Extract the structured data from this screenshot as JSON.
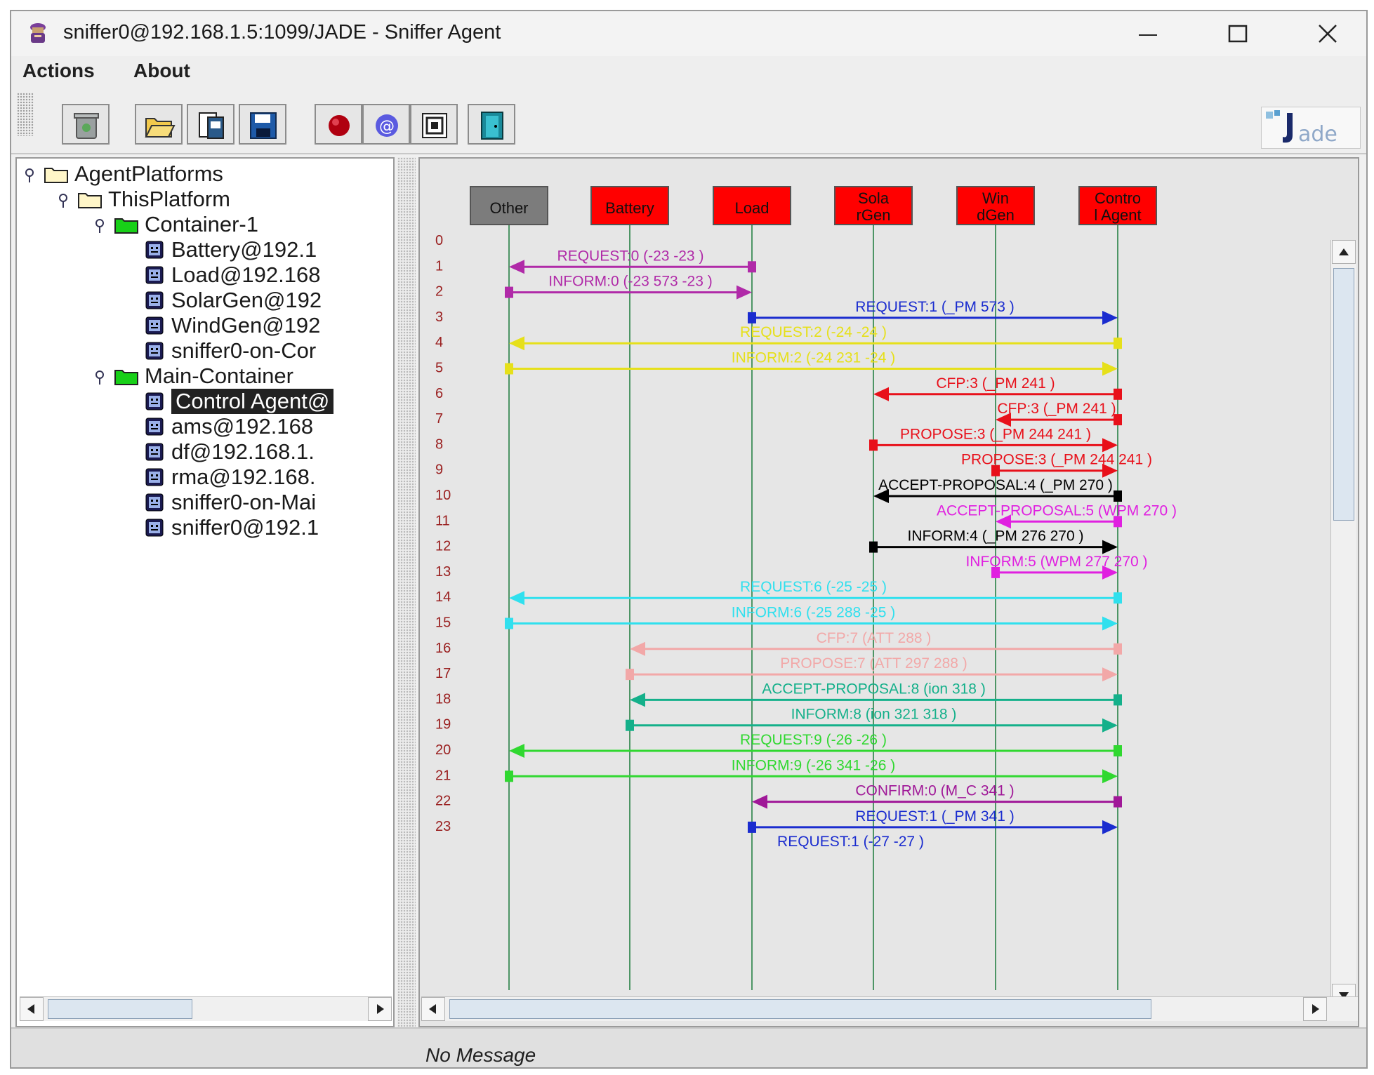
{
  "window": {
    "title": "sniffer0@192.168.1.5:1099/JADE - Sniffer Agent",
    "minimize_icon": "minimize-icon",
    "maximize_icon": "maximize-icon",
    "close_icon": "close-icon"
  },
  "menu": {
    "items": [
      "Actions",
      "About"
    ]
  },
  "toolbar": {
    "buttons": [
      {
        "icon": "trash-icon"
      },
      {
        "icon": "open-folder-icon"
      },
      {
        "icon": "document-icon"
      },
      {
        "icon": "save-icon"
      },
      {
        "icon": "record-icon"
      },
      {
        "icon": "at-icon"
      },
      {
        "icon": "filter-icon"
      },
      {
        "icon": "exit-door-icon"
      }
    ],
    "logo": "Jade"
  },
  "tree": {
    "nodes": [
      {
        "label": "AgentPlatforms",
        "type": "folder"
      },
      {
        "label": "ThisPlatform",
        "type": "folder"
      },
      {
        "label": "Container-1",
        "type": "container"
      },
      {
        "label": "Battery@192.1",
        "type": "agent"
      },
      {
        "label": "Load@192.168",
        "type": "agent"
      },
      {
        "label": "SolarGen@192",
        "type": "agent"
      },
      {
        "label": "WindGen@192",
        "type": "agent"
      },
      {
        "label": "sniffer0-on-Cor",
        "type": "agent"
      },
      {
        "label": "Main-Container",
        "type": "container"
      },
      {
        "label": "Control Agent@",
        "type": "agent",
        "selected": true
      },
      {
        "label": "ams@192.168",
        "type": "agent"
      },
      {
        "label": "df@192.168.1.",
        "type": "agent"
      },
      {
        "label": "rma@192.168.",
        "type": "agent"
      },
      {
        "label": "sniffer0-on-Mai",
        "type": "agent"
      },
      {
        "label": "sniffer0@192.1",
        "type": "agent"
      }
    ]
  },
  "diagram": {
    "agents": [
      {
        "label": "Other",
        "color": "#7c7c7c"
      },
      {
        "label": "Battery",
        "color": "#ff0000"
      },
      {
        "label": "Load",
        "color": "#ff0000"
      },
      {
        "label": "Sola\nrGen",
        "color": "#ff0000"
      },
      {
        "label": "Win\ndGen",
        "color": "#ff0000"
      },
      {
        "label": "Contro\nl Agent",
        "color": "#ff0000"
      }
    ],
    "row_numbers": [
      "0",
      "1",
      "2",
      "3",
      "4",
      "5",
      "6",
      "7",
      "8",
      "9",
      "10",
      "11",
      "12",
      "13",
      "14",
      "15",
      "16",
      "17",
      "18",
      "19",
      "20",
      "21",
      "22",
      "23"
    ],
    "messages": [
      {
        "row": 1,
        "from": 2,
        "to": 0,
        "label": "REQUEST:0 (-23  -23    )",
        "color": "#b02aa8"
      },
      {
        "row": 2,
        "from": 0,
        "to": 2,
        "label": "INFORM:0 (-23  573  -23 )",
        "color": "#b02aa8"
      },
      {
        "row": 3,
        "from": 2,
        "to": 5,
        "label": "REQUEST:1 (_PM  573    )",
        "color": "#1a2ccf"
      },
      {
        "row": 4,
        "from": 5,
        "to": 0,
        "label": "REQUEST:2 (-24  -24    )",
        "color": "#e6e01a"
      },
      {
        "row": 5,
        "from": 0,
        "to": 5,
        "label": "INFORM:2 (-24  231  -24 )",
        "color": "#e6e01a"
      },
      {
        "row": 6,
        "from": 5,
        "to": 3,
        "label": "CFP:3 (_PM  241    )",
        "color": "#e8101a"
      },
      {
        "row": 7,
        "from": 5,
        "to": 4,
        "label": "CFP:3 (_PM  241    )",
        "color": "#e8101a"
      },
      {
        "row": 8,
        "from": 3,
        "to": 5,
        "label": "PROPOSE:3 (_PM  244  241 )",
        "color": "#e8101a"
      },
      {
        "row": 9,
        "from": 4,
        "to": 5,
        "label": "PROPOSE:3 (_PM  244  241 )",
        "color": "#e8101a"
      },
      {
        "row": 10,
        "from": 5,
        "to": 3,
        "label": "ACCEPT-PROPOSAL:4 (_PM  270    )",
        "color": "#000000"
      },
      {
        "row": 11,
        "from": 5,
        "to": 4,
        "label": "ACCEPT-PROPOSAL:5 (WPM  270    )",
        "color": "#e020e0"
      },
      {
        "row": 12,
        "from": 3,
        "to": 5,
        "label": "INFORM:4 (_PM  276  270 )",
        "color": "#000000"
      },
      {
        "row": 13,
        "from": 4,
        "to": 5,
        "label": "INFORM:5 (WPM  277  270 )",
        "color": "#e020e0"
      },
      {
        "row": 14,
        "from": 5,
        "to": 0,
        "label": "REQUEST:6 (-25  -25    )",
        "color": "#30e0ee"
      },
      {
        "row": 15,
        "from": 0,
        "to": 5,
        "label": "INFORM:6 (-25  288  -25 )",
        "color": "#30e0ee"
      },
      {
        "row": 16,
        "from": 5,
        "to": 1,
        "label": "CFP:7 (ATT  288    )",
        "color": "#f2a8a8"
      },
      {
        "row": 17,
        "from": 1,
        "to": 5,
        "label": "PROPOSE:7 (ATT  297  288 )",
        "color": "#f2a8a8"
      },
      {
        "row": 18,
        "from": 5,
        "to": 1,
        "label": "ACCEPT-PROPOSAL:8 (ion  318    )",
        "color": "#14b08a"
      },
      {
        "row": 19,
        "from": 1,
        "to": 5,
        "label": "INFORM:8 (ion  321  318 )",
        "color": "#14b08a"
      },
      {
        "row": 20,
        "from": 5,
        "to": 0,
        "label": "REQUEST:9 (-26  -26    )",
        "color": "#30d830"
      },
      {
        "row": 21,
        "from": 0,
        "to": 5,
        "label": "INFORM:9 (-26  341  -26 )",
        "color": "#30d830"
      },
      {
        "row": 22,
        "from": 5,
        "to": 2,
        "label": "CONFIRM:0 (M_C  341    )",
        "color": "#a01898"
      },
      {
        "row": 23,
        "from": 2,
        "to": 5,
        "label": "REQUEST:1 (_PM  341    )",
        "color": "#1a2ccf"
      }
    ],
    "partial_row_label": "REQUEST:1 (-27  -27    )",
    "partial_row_color": "#1a2ccf"
  },
  "status": {
    "message": "No Message"
  }
}
